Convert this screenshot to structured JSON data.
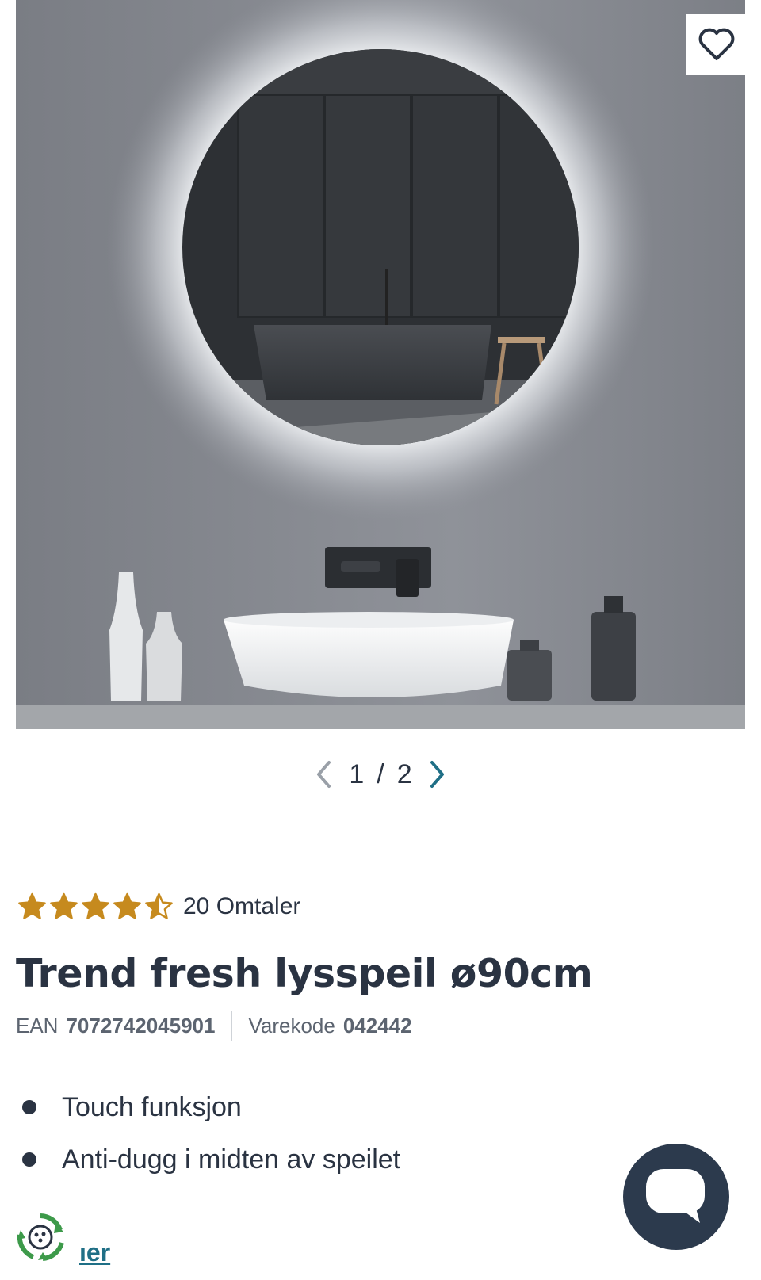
{
  "gallery": {
    "current": "1",
    "separator": "/",
    "total": "2",
    "image_alt_name": "round-led-mirror-bathroom-photo"
  },
  "rating": {
    "stars": 4.5,
    "max": 5,
    "review_text": "20 Omtaler",
    "star_color": "#c68a1e"
  },
  "product": {
    "title": "Trend fresh lysspeil ø90cm",
    "ean_label": "EAN",
    "ean_value": "7072742045901",
    "code_label": "Varekode",
    "code_value": "042442"
  },
  "features": [
    "Touch funksjon",
    "Anti-dugg i midten av speilet"
  ],
  "bottom": {
    "link_text": "ıer",
    "link_color": "#1f6f86"
  },
  "colors": {
    "text": "#2a3342",
    "chat_bg": "#2c3a4d",
    "pager_active": "#1f6f86",
    "pager_inactive": "#9aa0a8"
  }
}
